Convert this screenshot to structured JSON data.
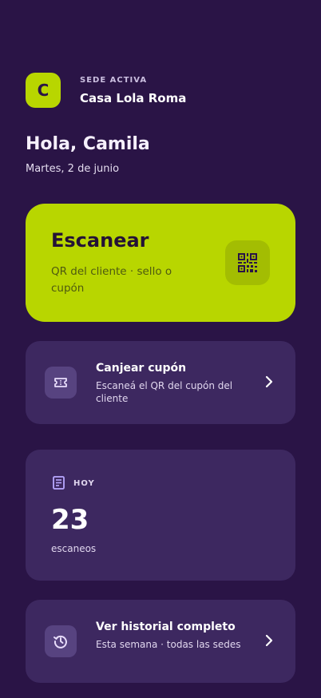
{
  "header": {
    "logo_letter": "C",
    "sede_label": "SEDE ACTIVA",
    "sede_name": "Casa Lola Roma"
  },
  "greeting": "Hola, Camila",
  "date": "Martes, 2 de junio",
  "scan": {
    "title": "Escanear",
    "subtitle": "QR del cliente · sello o cupón",
    "icon": "qr-code-icon"
  },
  "coupon": {
    "title": "Canjear cupón",
    "subtitle": "Escaneá el QR del cupón del cliente",
    "icon": "ticket-icon"
  },
  "stats": {
    "label": "HOY",
    "value": "23",
    "unit": "escaneos",
    "icon": "receipt-icon"
  },
  "history": {
    "title": "Ver historial completo",
    "subtitle": "Esta semana · todas las sedes",
    "icon": "history-icon"
  },
  "colors": {
    "background": "#2a1446",
    "accent": "#b8d600",
    "card": "#3d2860",
    "icon_accent": "#b9a8ff"
  }
}
